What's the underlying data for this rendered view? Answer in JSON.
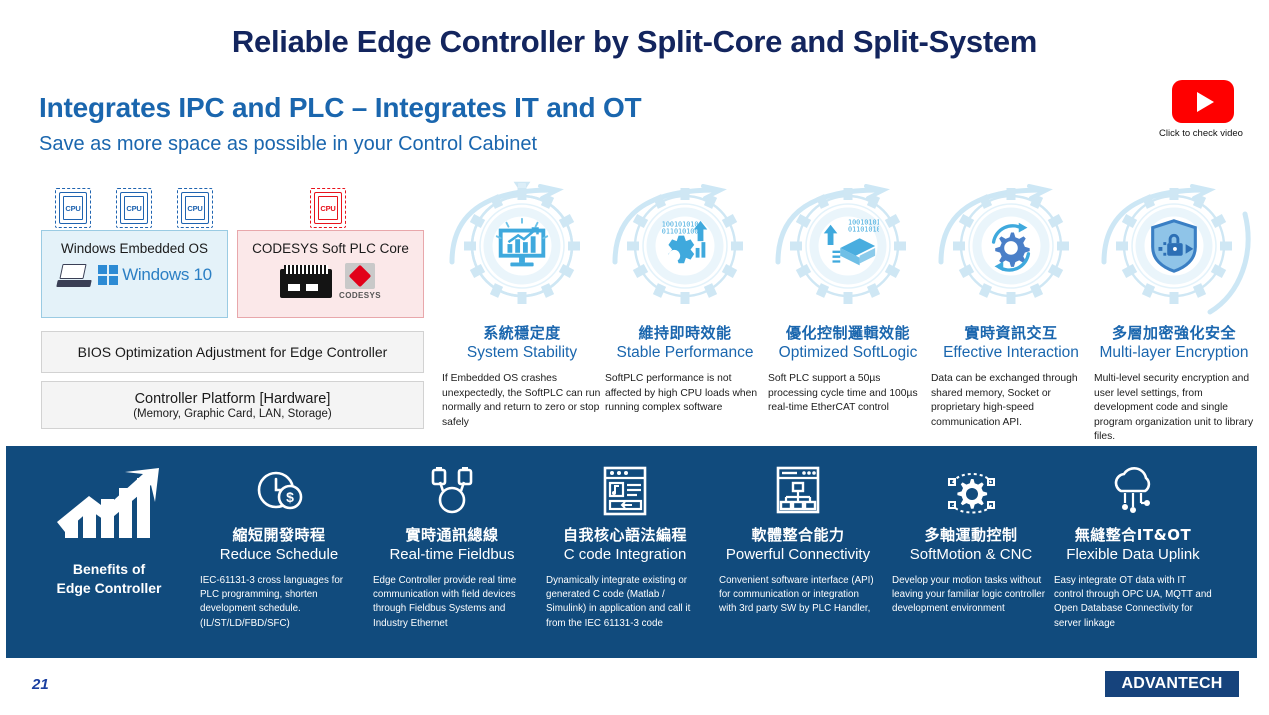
{
  "slide": {
    "title": "Reliable Edge Controller by Split-Core and Split-System",
    "heading": "Integrates IPC and PLC – Integrates IT and OT",
    "subheading": "Save as more space as possible in your Control Cabinet",
    "page_number": "21",
    "brand": "ADVANTECH"
  },
  "video": {
    "caption": "Click to check video",
    "icon": "youtube-play-icon",
    "color": "#FF0000"
  },
  "architecture": {
    "cpus": [
      {
        "label": "CPU",
        "color": "#1E63B0"
      },
      {
        "label": "CPU",
        "color": "#1E63B0"
      },
      {
        "label": "CPU",
        "color": "#1E63B0"
      },
      {
        "label": "CPU",
        "color": "#E8121B"
      }
    ],
    "os_box": {
      "label": "Windows Embedded OS",
      "logo_text": "Windows 10",
      "fill": "#E4F2F9",
      "border": "#9ACBE3"
    },
    "plc_box": {
      "label": "CODESYS Soft PLC Core",
      "logo_text": "CODESYS",
      "fill": "#FBE8E9",
      "border": "#E8A7AB"
    },
    "bios_row": "BIOS Optimization Adjustment for Edge Controller",
    "platform_row": {
      "line1": "Controller Platform [Hardware]",
      "line2": "(Memory, Graphic Card, LAN, Storage)"
    }
  },
  "features": [
    {
      "cn": "系統穩定度",
      "en": "System Stability",
      "icon": "monitor-chart-icon",
      "desc": "If Embedded OS crashes unexpectedly, the SoftPLC can run normally and return to zero or stop safely"
    },
    {
      "cn": "維持即時效能",
      "en": "Stable Performance",
      "icon": "gear-bars-arrow-icon",
      "desc": "SoftPLC performance is not affected by high CPU loads when running complex software"
    },
    {
      "cn": "優化控制邏輯效能",
      "en": "Optimized SoftLogic",
      "icon": "chip-arrow-icon",
      "desc": "Soft PLC support a 50µs processing cycle time and 100µs real-time EtherCAT control"
    },
    {
      "cn": "實時資訊交互",
      "en": "Effective Interaction",
      "icon": "gear-cycle-icon",
      "desc": "Data can be exchanged through shared memory, Socket or proprietary high-speed communication API."
    },
    {
      "cn": "多層加密強化安全",
      "en": "Multi-layer Encryption",
      "icon": "shield-lock-icon",
      "desc": "Multi-level security encryption and user level settings, from development code and single program organization unit to library files."
    }
  ],
  "benefits": {
    "header_icon": "growth-chart-arrow-icon",
    "header_line1": "Benefits of",
    "header_line2": "Edge Controller",
    "background": "#114B7D",
    "items": [
      {
        "cn": "縮短開發時程",
        "en": "Reduce Schedule",
        "icon": "clock-dollar-icon",
        "desc": "IEC-61131-3 cross languages for PLC programming, shorten development schedule. (IL/ST/LD/FBD/SFC)"
      },
      {
        "cn": "實時通訊總線",
        "en": "Real-time Fieldbus",
        "icon": "fieldbus-cable-icon",
        "desc": "Edge Controller provide real time communication with field devices through Fieldbus Systems and Industry Ethernet"
      },
      {
        "cn": "自我核心語法編程",
        "en": "C code Integration",
        "icon": "code-window-icon",
        "desc": "Dynamically integrate existing or generated C code (Matlab / Simulink) in application and call it from the IEC 61131-3 code"
      },
      {
        "cn": "軟體整合能力",
        "en": "Powerful Connectivity",
        "icon": "network-window-icon",
        "desc": "Convenient software interface (API) for communication or integration with 3rd party SW by PLC Handler,"
      },
      {
        "cn": "多軸運動控制",
        "en": "SoftMotion & CNC",
        "icon": "motion-gear-icon",
        "desc": "Develop your motion tasks without leaving your familiar logic controller development environment"
      },
      {
        "cn": "無縫整合IT&OT",
        "en": "Flexible Data Uplink",
        "icon": "cloud-network-icon",
        "desc": "Easy integrate OT data with IT control through OPC UA, MQTT and Open Database Connectivity for server linkage"
      }
    ]
  },
  "colors": {
    "title_navy": "#13255E",
    "accent_blue": "#1A66AE",
    "icon_blue": "#3FA9DD",
    "gear_outline": "#D6EAF5",
    "banner": "#114B7D"
  }
}
